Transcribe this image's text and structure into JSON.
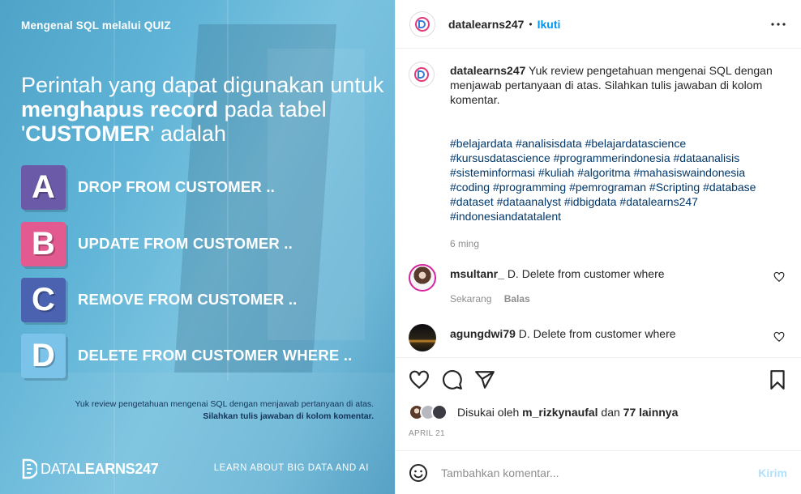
{
  "post_image": {
    "quiz_label": "Mengenal SQL melalui QUIZ",
    "question": {
      "part1": "Perintah yang dapat digunakan untuk ",
      "bold1": "menghapus record",
      "part2": " pada tabel '",
      "bold2": "CUSTOMER",
      "part3": "'  adalah"
    },
    "options": [
      {
        "letter": "A",
        "text": "DROP FROM CUSTOMER .."
      },
      {
        "letter": "B",
        "text": "UPDATE FROM CUSTOMER .."
      },
      {
        "letter": "C",
        "text": "REMOVE FROM CUSTOMER .."
      },
      {
        "letter": "D",
        "text": "DELETE FROM CUSTOMER WHERE .."
      }
    ],
    "footnote_line1": "Yuk review pengetahuan mengenai SQL dengan menjawab pertanyaan di atas.",
    "footnote_line2": "Silahkan tulis jawaban di kolom komentar.",
    "brand_bold": "DATA",
    "brand_rest": "LEARNS247",
    "brand_tagline": "LEARN ABOUT BIG DATA AND AI"
  },
  "header": {
    "username": "datalearns247",
    "separator": "•",
    "follow_label": "Ikuti",
    "more_icon": "more-horizontal-icon"
  },
  "caption": {
    "username": "datalearns247",
    "text": "Yuk review pengetahuan mengenai SQL dengan menjawab pertanyaan di atas. Silahkan tulis jawaban di kolom komentar.",
    "hashtags": [
      "#belajardata",
      "#analisisdata",
      "#belajardatascience",
      "#kursusdatascience",
      "#programmerindonesia",
      "#dataanalisis",
      "#sisteminformasi",
      "#kuliah",
      "#algoritma",
      "#mahasiswaindonesia",
      "#coding",
      "#programming",
      "#pemrograman",
      "#Scripting",
      "#database",
      "#dataset",
      "#dataanalyst",
      "#idbigdata",
      "#datalearns247",
      "#indonesiandatatalent"
    ],
    "time": "6 ming"
  },
  "comments": [
    {
      "username": "msultanr_",
      "text": "D. Delete from customer where",
      "time": "Sekarang",
      "reply_label": "Balas"
    },
    {
      "username": "agungdwi79",
      "text": "D. Delete from customer where"
    }
  ],
  "likes": {
    "prefix": "Disukai oleh",
    "user": "m_rizkynaufal",
    "middle": "dan",
    "others": "77 lainnya"
  },
  "post_date": "APRIL 21",
  "add_comment": {
    "placeholder": "Tambahkan komentar...",
    "post_label": "Kirim"
  },
  "colors": {
    "accent": "#0095f6",
    "post_button_disabled": "#b2dffc",
    "hashtag": "#00376b",
    "option_a": "#6b5aa8",
    "option_b": "#e25a8f",
    "option_c": "#4a62b0",
    "option_d": "#7cc3ea"
  }
}
